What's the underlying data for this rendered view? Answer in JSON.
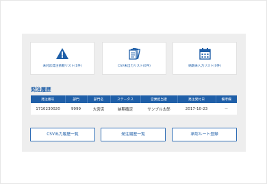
{
  "cards": [
    {
      "icon": "warning-icon",
      "label": "未対応発注依頼リスト(1件)"
    },
    {
      "icon": "csv-documents-icon",
      "label": "CSV未出力リスト(0件)"
    },
    {
      "icon": "calendar-icon",
      "label": "納期未入力リスト(0件)"
    }
  ],
  "order_history": {
    "title": "発注履歴",
    "columns": [
      "発注番号",
      "部門",
      "部門名",
      "ステータス",
      "営業担当者",
      "発注受付日",
      "備考欄"
    ],
    "rows": [
      [
        "1710230020",
        "9999",
        "大宮店",
        "納期確定",
        "サンプル太郎",
        "2017-10-23",
        "－"
      ]
    ]
  },
  "buttons": {
    "csv_history": "CSV出力履歴一覧",
    "order_history": "発注履歴一覧",
    "approval_route": "承認ルート登録"
  },
  "colors": {
    "accent": "#1f5fa8",
    "panel_bg": "#eeeeee"
  }
}
